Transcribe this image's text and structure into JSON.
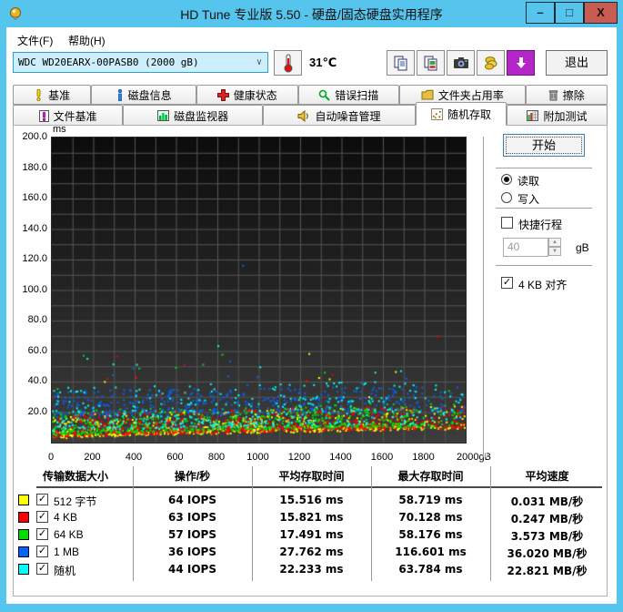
{
  "window": {
    "title": "HD Tune 专业版 5.50 - 硬盘/固态硬盘实用程序",
    "minimize": "–",
    "maximize": "□",
    "close": "X"
  },
  "menu": {
    "file": "文件(F)",
    "help": "帮助(H)"
  },
  "toolbar": {
    "drive_select": "WDC WD20EARX-00PASB0 (2000 gB)",
    "temperature": "31℃",
    "exit_label": "退出"
  },
  "tabs": {
    "row1": [
      {
        "label": "基准"
      },
      {
        "label": "磁盘信息"
      },
      {
        "label": "健康状态"
      },
      {
        "label": "错误扫描"
      },
      {
        "label": "文件夹占用率"
      },
      {
        "label": "擦除"
      }
    ],
    "row2": [
      {
        "label": "文件基准"
      },
      {
        "label": "磁盘监视器"
      },
      {
        "label": "自动噪音管理"
      },
      {
        "label": "随机存取"
      },
      {
        "label": "附加测试"
      }
    ],
    "selected": "随机存取"
  },
  "controls": {
    "start_label": "开始",
    "read_label": "读取",
    "read_checked": true,
    "write_label": "写入",
    "write_checked": false,
    "short_stroke_label": "快捷行程",
    "short_stroke_checked": false,
    "capacity_value": "40",
    "capacity_unit": "gB",
    "align_label": "4 KB 对齐",
    "align_checked": true,
    "check_glyph": "✓"
  },
  "chart_data": {
    "type": "scatter",
    "title": "随机存取 访问时间 vs 磁盘位置",
    "xlabel": "gB",
    "ylabel": "ms",
    "xlim": [
      0,
      2000
    ],
    "ylim": [
      0,
      200
    ],
    "grid": {
      "x_step_gb": 100,
      "y_step_ms": 10,
      "on": true
    },
    "y_unit_label": "ms",
    "y_ticks": [
      "200.0",
      "180.0",
      "160.0",
      "140.0",
      "120.0",
      "100.0",
      "80.0",
      "60.0",
      "40.0",
      "20.0"
    ],
    "y_tick_values": [
      200,
      180,
      160,
      140,
      120,
      100,
      80,
      60,
      40,
      20
    ],
    "x_ticks": [
      "0",
      "200",
      "400",
      "600",
      "800",
      "1000",
      "1200",
      "1400",
      "1600",
      "1800",
      "2000gB"
    ],
    "x_tick_values": [
      0,
      200,
      400,
      600,
      800,
      1000,
      1200,
      1400,
      1600,
      1800,
      2000
    ],
    "bg_gradient": [
      "#0c0c0c",
      "#3d3d3d"
    ],
    "grid_color": "#565656",
    "seed": 20130550,
    "series": [
      {
        "name": "512 字节",
        "color": "#ffff00",
        "stats": {
          "iops": 64,
          "avg_ms": 15.516,
          "max_ms": 58.719,
          "speed_mb_s": 0.031
        },
        "band": {
          "env0": 3.5,
          "env1": 10,
          "spread": 15,
          "exp": 2.4,
          "count": 620,
          "outliers": {
            "count": 6,
            "min": 30,
            "max": 52
          },
          "extra": [
            [
              1240,
              58.7
            ]
          ]
        }
      },
      {
        "name": "4 KB",
        "color": "#ff0000",
        "stats": {
          "iops": 63,
          "avg_ms": 15.821,
          "max_ms": 70.128,
          "speed_mb_s": 0.247
        },
        "band": {
          "env0": 4,
          "env1": 10.5,
          "spread": 15,
          "exp": 2.4,
          "count": 620,
          "outliers": {
            "count": 6,
            "min": 30,
            "max": 57
          },
          "extra": [
            [
              1860,
              70.1
            ],
            [
              310,
              57.0
            ]
          ]
        }
      },
      {
        "name": "64 KB",
        "color": "#00e000",
        "stats": {
          "iops": 57,
          "avg_ms": 17.491,
          "max_ms": 58.176,
          "speed_mb_s": 3.573
        },
        "band": {
          "env0": 5.5,
          "env1": 12,
          "spread": 15,
          "exp": 2.2,
          "count": 540,
          "outliers": {
            "count": 6,
            "min": 30,
            "max": 55
          },
          "extra": [
            [
              150,
              57.5
            ],
            [
              820,
              58.2
            ]
          ]
        }
      },
      {
        "name": "1 MB",
        "color": "#0064ff",
        "stats": {
          "iops": 36,
          "avg_ms": 27.762,
          "max_ms": 116.601,
          "speed_mb_s": 36.02
        },
        "band": {
          "env0": 17,
          "env1": 21,
          "spread": 17,
          "exp": 1.3,
          "count": 400,
          "outliers": {
            "count": 8,
            "min": 38,
            "max": 62
          },
          "extra": [
            [
              920,
              116.6
            ]
          ]
        }
      },
      {
        "name": "随机",
        "color": "#00ffff",
        "stats": {
          "iops": 44,
          "avg_ms": 22.233,
          "max_ms": 63.784,
          "speed_mb_s": 22.821
        },
        "band": {
          "env0": 8,
          "env1": 13,
          "spread": 28,
          "exp": 1.9,
          "count": 400,
          "outliers": {
            "count": 7,
            "min": 40,
            "max": 60
          },
          "extra": [
            [
              800,
              63.8
            ]
          ]
        }
      }
    ]
  },
  "table": {
    "headers": [
      "传输数据大小",
      "操作/秒",
      "平均存取时间",
      "最大存取时间",
      "平均速度"
    ],
    "rows": [
      {
        "color": "#ffff00",
        "checked": true,
        "label": "512 字节",
        "iops": "64 IOPS",
        "avg": "15.516 ms",
        "max": "58.719 ms",
        "speed": "0.031 MB/秒"
      },
      {
        "color": "#ff0000",
        "checked": true,
        "label": "4 KB",
        "iops": "63 IOPS",
        "avg": "15.821 ms",
        "max": "70.128 ms",
        "speed": "0.247 MB/秒"
      },
      {
        "color": "#00e000",
        "checked": true,
        "label": "64 KB",
        "iops": "57 IOPS",
        "avg": "17.491 ms",
        "max": "58.176 ms",
        "speed": "3.573 MB/秒"
      },
      {
        "color": "#0064ff",
        "checked": true,
        "label": "1 MB",
        "iops": "36 IOPS",
        "avg": "27.762 ms",
        "max": "116.601 ms",
        "speed": "36.020 MB/秒"
      },
      {
        "color": "#00ffff",
        "checked": true,
        "label": "随机",
        "iops": "44 IOPS",
        "avg": "22.233 ms",
        "max": "63.784 ms",
        "speed": "22.821 MB/秒"
      }
    ]
  }
}
